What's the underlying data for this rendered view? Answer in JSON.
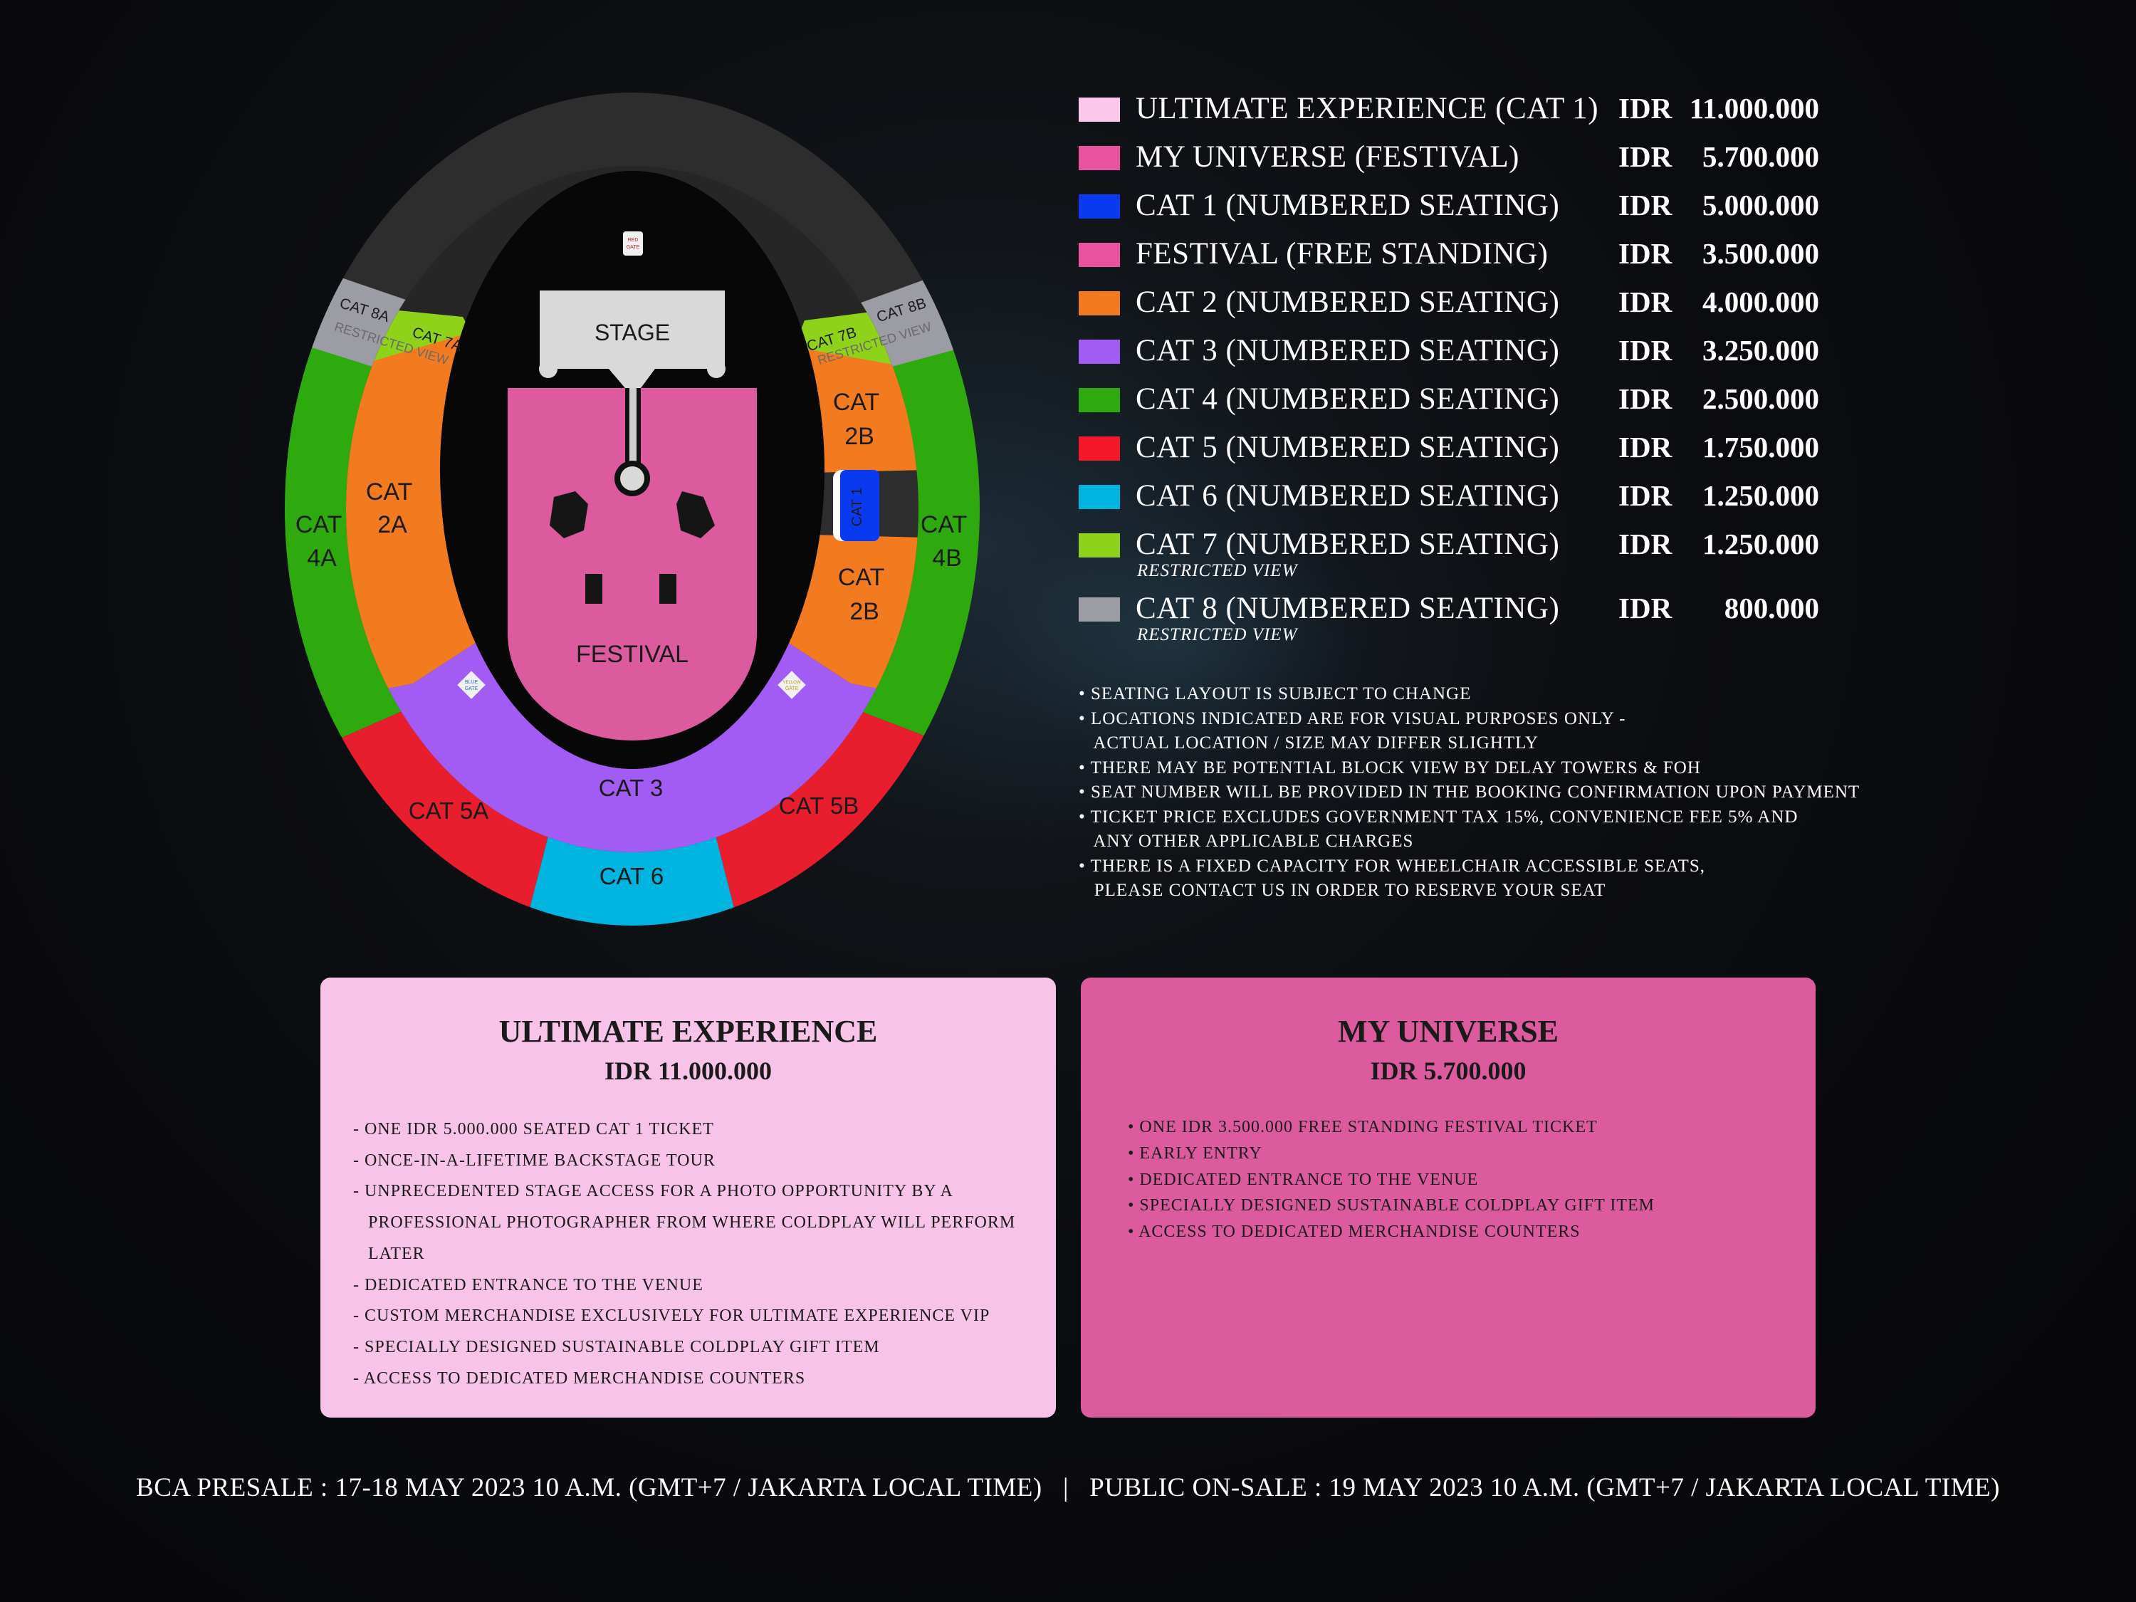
{
  "seatmap": {
    "stage": "STAGE",
    "festival": "FESTIVAL",
    "red_gate": "RED GATE",
    "blue_gate": "BLUE GATE",
    "yellow_gate": "YELLOW GATE",
    "restricted": "RESTRICTED VIEW",
    "cat8a": "CAT 8A",
    "cat8b": "CAT 8B",
    "cat7a": "CAT 7A",
    "cat7b": "CAT 7B",
    "cat4a": [
      "CAT",
      "4A"
    ],
    "cat4b": [
      "CAT",
      "4B"
    ],
    "cat2a": [
      "CAT",
      "2A"
    ],
    "cat2b_top": [
      "CAT",
      "2B"
    ],
    "cat2b_bottom": [
      "CAT",
      "2B"
    ],
    "cat1": "CAT 1",
    "cat3": "CAT 3",
    "cat5a": "CAT 5A",
    "cat5b": "CAT 5B",
    "cat6": "CAT 6"
  },
  "colors": {
    "ultimate": "#fbc8ec",
    "my_universe": "#e8529e",
    "cat1": "#0a3af0",
    "festival": "#dc5a9e",
    "cat2": "#f27b1f",
    "cat3": "#a25cf4",
    "cat4": "#2faa0e",
    "cat5": "#e81e2f",
    "cat6": "#00b4e0",
    "cat7": "#8ed31a",
    "cat8": "#9b9ca4",
    "ring": "#2d2d2d",
    "stage": "#d9d9d9",
    "card_ue": "#f8c3e8",
    "card_mu": "#dc5a9e"
  },
  "legend": [
    {
      "name": "ULTIMATE EXPERIENCE (CAT 1)",
      "currency": "IDR",
      "price": "11.000.000",
      "color": "#fbc8ec",
      "sub": ""
    },
    {
      "name": "MY UNIVERSE (FESTIVAL)",
      "currency": "IDR",
      "price": "5.700.000",
      "color": "#e8529e",
      "sub": ""
    },
    {
      "name": "CAT 1 (NUMBERED SEATING)",
      "currency": "IDR",
      "price": "5.000.000",
      "color": "#0a3af0",
      "sub": ""
    },
    {
      "name": "FESTIVAL (FREE STANDING)",
      "currency": "IDR",
      "price": "3.500.000",
      "color": "#e8529e",
      "sub": ""
    },
    {
      "name": "CAT 2 (NUMBERED SEATING)",
      "currency": "IDR",
      "price": "4.000.000",
      "color": "#f27b1f",
      "sub": ""
    },
    {
      "name": "CAT 3 (NUMBERED SEATING)",
      "currency": "IDR",
      "price": "3.250.000",
      "color": "#a25cf4",
      "sub": ""
    },
    {
      "name": "CAT 4 (NUMBERED SEATING)",
      "currency": "IDR",
      "price": "2.500.000",
      "color": "#2faa0e",
      "sub": ""
    },
    {
      "name": "CAT 5 (NUMBERED SEATING)",
      "currency": "IDR",
      "price": "1.750.000",
      "color": "#f5182a",
      "sub": ""
    },
    {
      "name": "CAT 6 (NUMBERED SEATING)",
      "currency": "IDR",
      "price": "1.250.000",
      "color": "#00b4e0",
      "sub": ""
    },
    {
      "name": "CAT 7 (NUMBERED SEATING)",
      "currency": "IDR",
      "price": "1.250.000",
      "color": "#8ed31a",
      "sub": "RESTRICTED VIEW"
    },
    {
      "name": "CAT 8 (NUMBERED SEATING)",
      "currency": "IDR",
      "price": "800.000",
      "color": "#9b9ca4",
      "sub": "RESTRICTED VIEW"
    }
  ],
  "notes": [
    "• SEATING LAYOUT IS SUBJECT TO CHANGE",
    "• LOCATIONS INDICATED ARE FOR VISUAL PURPOSES ONLY -",
    "   ACTUAL LOCATION / SIZE MAY DIFFER SLIGHTLY",
    "• THERE MAY BE POTENTIAL BLOCK VIEW BY DELAY TOWERS & FOH",
    "• SEAT NUMBER WILL BE PROVIDED IN THE BOOKING CONFIRMATION UPON PAYMENT",
    "• TICKET PRICE EXCLUDES GOVERNMENT TAX 15%, CONVENIENCE FEE 5% AND",
    "   ANY OTHER APPLICABLE CHARGES",
    "• THERE IS A FIXED CAPACITY FOR WHEELCHAIR ACCESSIBLE SEATS,",
    "   PLEASE CONTACT US IN ORDER TO RESERVE YOUR SEAT"
  ],
  "ultimate_card": {
    "title": "ULTIMATE EXPERIENCE",
    "price": "IDR 11.000.000",
    "items": [
      "- ONE IDR 5.000.000 SEATED CAT 1 TICKET",
      "- ONCE-IN-A-LIFETIME BACKSTAGE TOUR",
      "- UNPRECEDENTED STAGE ACCESS FOR A PHOTO OPPORTUNITY BY A",
      "   PROFESSIONAL PHOTOGRAPHER FROM WHERE COLDPLAY WILL PERFORM",
      "   LATER",
      "- DEDICATED ENTRANCE TO THE VENUE",
      "- CUSTOM MERCHANDISE EXCLUSIVELY FOR ULTIMATE EXPERIENCE VIP",
      "- SPECIALLY DESIGNED SUSTAINABLE COLDPLAY GIFT ITEM",
      "- ACCESS TO DEDICATED MERCHANDISE COUNTERS"
    ]
  },
  "universe_card": {
    "title": "MY UNIVERSE",
    "price": "IDR 5.700.000",
    "items": [
      "• ONE IDR 3.500.000 FREE STANDING FESTIVAL TICKET",
      "• EARLY ENTRY",
      "• DEDICATED ENTRANCE TO THE VENUE",
      "• SPECIALLY DESIGNED SUSTAINABLE COLDPLAY GIFT ITEM",
      "• ACCESS TO DEDICATED MERCHANDISE COUNTERS"
    ]
  },
  "footer": {
    "presale": "BCA PRESALE : 17-18 MAY 2023 10 A.M. (GMT+7 / JAKARTA LOCAL TIME)",
    "separator": "|",
    "onsale": "PUBLIC ON-SALE : 19 MAY 2023 10 A.M. (GMT+7 / JAKARTA LOCAL TIME)"
  }
}
